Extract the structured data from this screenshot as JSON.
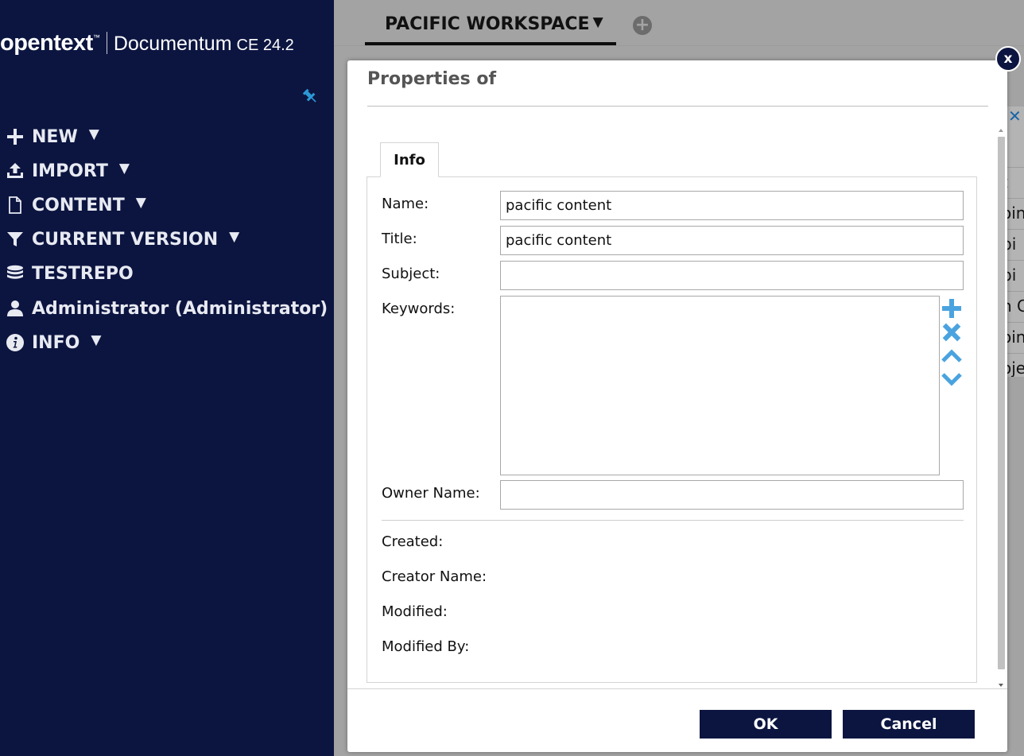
{
  "brand": {
    "logo": "opentext",
    "trademark": "™",
    "product": "Documentum",
    "version": "CE 24.2"
  },
  "sidebar": {
    "items": [
      {
        "label": "NEW",
        "icon": "plus-icon",
        "has_caret": true
      },
      {
        "label": "IMPORT",
        "icon": "upload-icon",
        "has_caret": true
      },
      {
        "label": "CONTENT",
        "icon": "document-icon",
        "has_caret": true
      },
      {
        "label": "CURRENT VERSION",
        "icon": "filter-icon",
        "has_caret": true
      },
      {
        "label": "TESTREPO",
        "icon": "database-icon",
        "has_caret": false
      },
      {
        "label": "Administrator (Administrator)",
        "icon": "user-icon",
        "has_caret": true
      },
      {
        "label": "INFO",
        "icon": "info-icon",
        "has_caret": true
      }
    ],
    "caret": "▼"
  },
  "workspace": {
    "tab_label": "PACIFIC WORKSPACE",
    "caret": "▼",
    "add_tab": "+"
  },
  "background_list": {
    "close": "✕",
    "rows": [
      "t",
      "oin",
      "bi",
      "bi",
      "n C",
      "oin",
      "oje"
    ]
  },
  "dialog": {
    "title": "Properties of",
    "close": "x",
    "tab": "Info",
    "fields": {
      "name_label": "Name:",
      "name_value": "pacific content",
      "title_label": "Title:",
      "title_value": "pacific content",
      "subject_label": "Subject:",
      "subject_value": "",
      "keywords_label": "Keywords:",
      "owner_label": "Owner Name:",
      "owner_value": "",
      "created_label": "Created:",
      "creator_label": "Creator Name:",
      "modified_label": "Modified:",
      "modified_by_label": "Modified By:"
    },
    "ok_label": "OK",
    "cancel_label": "Cancel"
  },
  "colors": {
    "sidebar_bg": "#0c1540",
    "accent_blue": "#4aa3df",
    "button_bg": "#0c1540",
    "overlay": "#a3a3a3"
  }
}
